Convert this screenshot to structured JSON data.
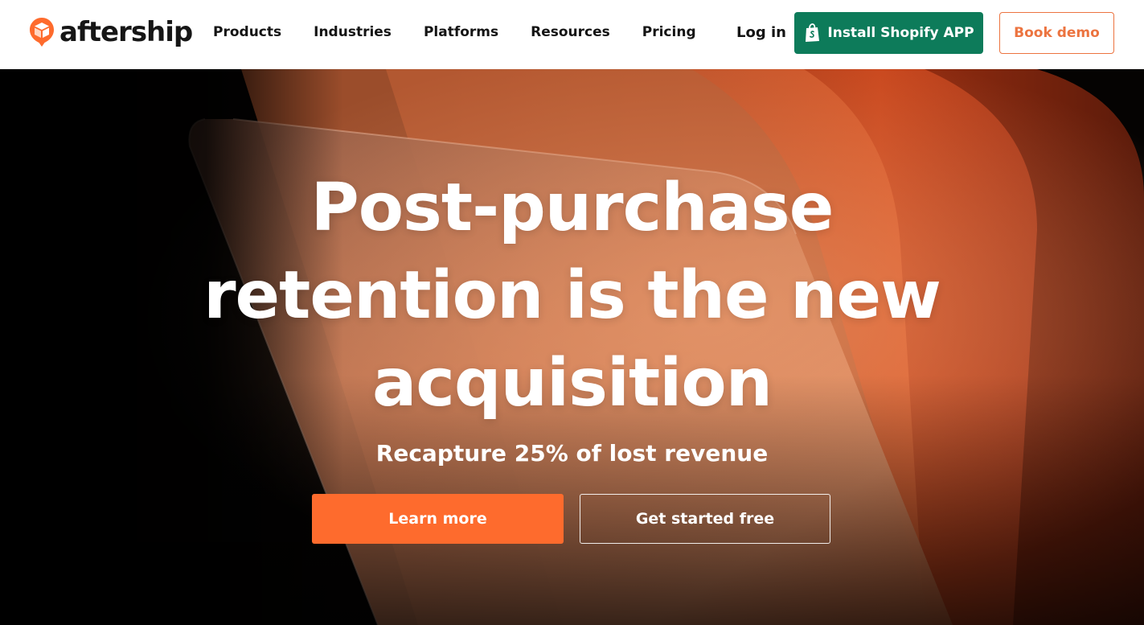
{
  "brand": {
    "name": "aftership",
    "color": "#fe6b2d"
  },
  "nav": {
    "items": [
      {
        "label": "Products"
      },
      {
        "label": "Industries"
      },
      {
        "label": "Platforms"
      },
      {
        "label": "Resources"
      },
      {
        "label": "Pricing"
      }
    ],
    "login_label": "Log in",
    "install_label": "Install Shopify APP",
    "install_icon": "shopify-bag-icon",
    "install_color": "#0d7b5a",
    "demo_label": "Book demo",
    "demo_color": "#ec7440"
  },
  "hero": {
    "headline": "Post-purchase retention is the new acquisition",
    "subheadline": "Recapture 25% of lost revenue",
    "primary_cta": "Learn more",
    "secondary_cta": "Get started free"
  }
}
